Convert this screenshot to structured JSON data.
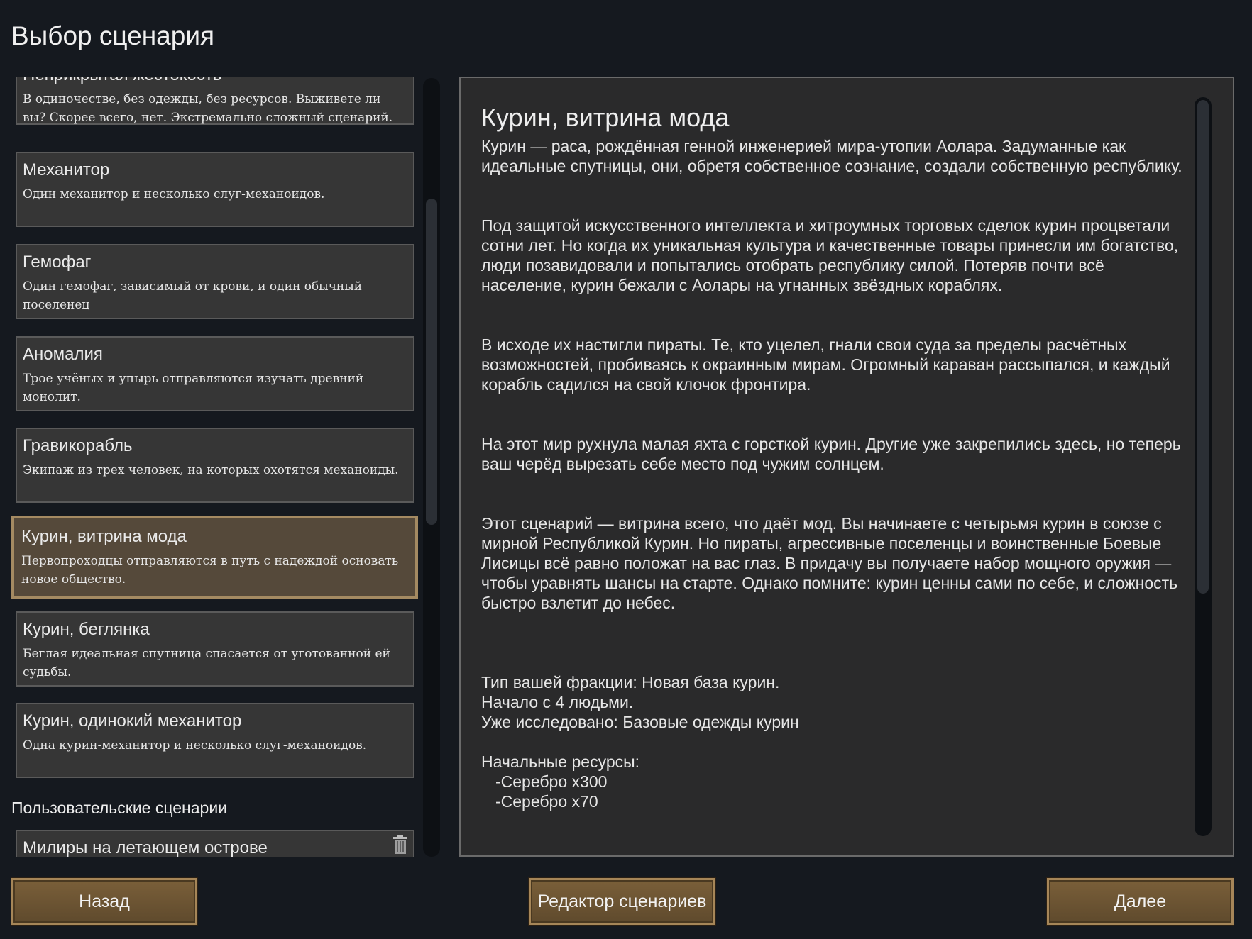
{
  "window": {
    "title": "Выбор сценария"
  },
  "scenarios": [
    {
      "name": "Неприкрытая жестокость",
      "desc": "В одиночестве, без одежды, без ресурсов. Выживете ли вы? Скорее всего, нет. Экстремально сложный сценарий."
    },
    {
      "name": "Механитор",
      "desc": "Один механитор и несколько слуг-механоидов."
    },
    {
      "name": "Гемофаг",
      "desc": "Один гемофаг, зависимый от крови, и один обычный поселенец"
    },
    {
      "name": "Аномалия",
      "desc": "Трое учёных и упырь отправляются изучать древний монолит."
    },
    {
      "name": "Гравикорабль",
      "desc": "Экипаж из трех человек, на которых охотятся механоиды."
    },
    {
      "name": "Курин, витрина мода",
      "desc": "Первопроходцы отправляются в путь с надеждой основать новое общество."
    },
    {
      "name": "Курин, беглянка",
      "desc": "Беглая идеальная спутница спасается от уготованной ей судьбы."
    },
    {
      "name": "Курин, одинокий механитор",
      "desc": "Одна курин-механитор и несколько слуг-механоидов."
    }
  ],
  "custom_section": {
    "label": "Пользовательские сценарии",
    "items": [
      {
        "name": "Милиры на летающем острове"
      }
    ]
  },
  "selected_scenario": {
    "title": "Курин, витрина мода",
    "paragraphs": [
      "Курин — раса, рождённая генной инженерией мира-утопии Аолара. Задуманные как идеальные спутницы, они, обретя собственное сознание, создали собственную республику.",
      "Под защитой искусственного интеллекта и хитроумных торговых сделок курин процветали сотни лет. Но когда их уникальная культура и качественные товары принесли им богатство, люди позавидовали и попытались отобрать республику силой. Потеряв почти всё население, курин бежали с Аолары на угнанных звёздных кораблях.",
      "В исходе их настигли пираты. Те, кто уцелел, гнали свои суда за пределы расчётных возможностей, пробиваясь к окраинным мирам. Огромный караван рассыпался, и каждый корабль садился на свой клочок фронтира.",
      "На этот мир рухнула малая яхта с горсткой курин. Другие уже закрепились здесь, но теперь ваш черёд вырезать себе место под чужим солнцем.",
      "Этот сценарий — витрина всего, что даёт мод. Вы начинаете с четырьмя курин в союзе с мирной Республикой Курин. Но пираты, агрессивные поселенцы и воинственные Боевые Лисицы всё равно положат на вас глаз. В придачу вы получаете набор мощного оружия — чтобы уравнять шансы на старте. Однако помните: курин ценны сами по себе, и сложность быстро взлетит до небес."
    ],
    "faction": "Тип вашей фракции: Новая база курин.",
    "start_people": "Начало с 4 людьми.",
    "researched": "Уже исследовано: Базовые одежды курин",
    "resources_label": "Начальные ресурсы:",
    "resources": [
      "-Серебро x300",
      "-Серебро x70"
    ]
  },
  "buttons": {
    "back": "Назад",
    "editor": "Редактор сценариев",
    "next": "Далее"
  }
}
